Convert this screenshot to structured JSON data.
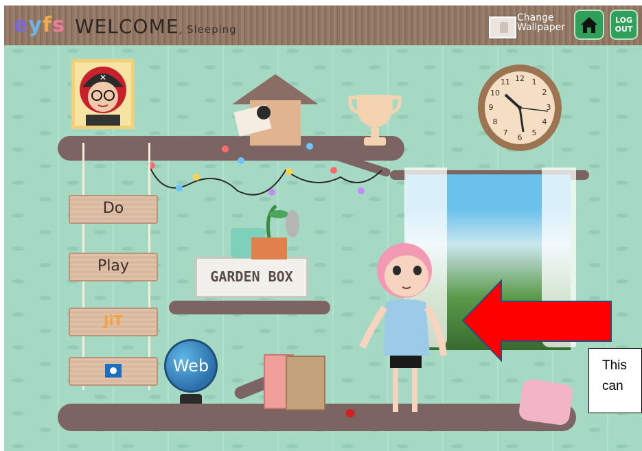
{
  "header": {
    "logo": {
      "e": "e",
      "y": "y",
      "f": "f",
      "s": "s"
    },
    "welcome": "WELCOME",
    "subtitle": ", Sleeping",
    "wallpaper_label_line1": "Change",
    "wallpaper_label_line2": "Wallpaper",
    "logout_line1": "LOG",
    "logout_line2": "OUT"
  },
  "menu": {
    "do": "Do",
    "play": "Play",
    "jit_label": "JiT",
    "web": "Web"
  },
  "garden_box": "GARDEN BOX",
  "clock_numbers": [
    "12",
    "1",
    "2",
    "3",
    "4",
    "5",
    "6",
    "7",
    "8",
    "9",
    "10",
    "11"
  ],
  "callout_text_line1": "This",
  "callout_text_line2": "can",
  "colors": {
    "frame_bg": "#a5d9c3",
    "topbar": "#8f7562",
    "button_green": "#2f9f5a",
    "arrow_red": "#ff0000"
  },
  "icons": [
    "home-icon",
    "avatar-icon",
    "clock-icon",
    "globe-icon",
    "arrow-icon"
  ]
}
